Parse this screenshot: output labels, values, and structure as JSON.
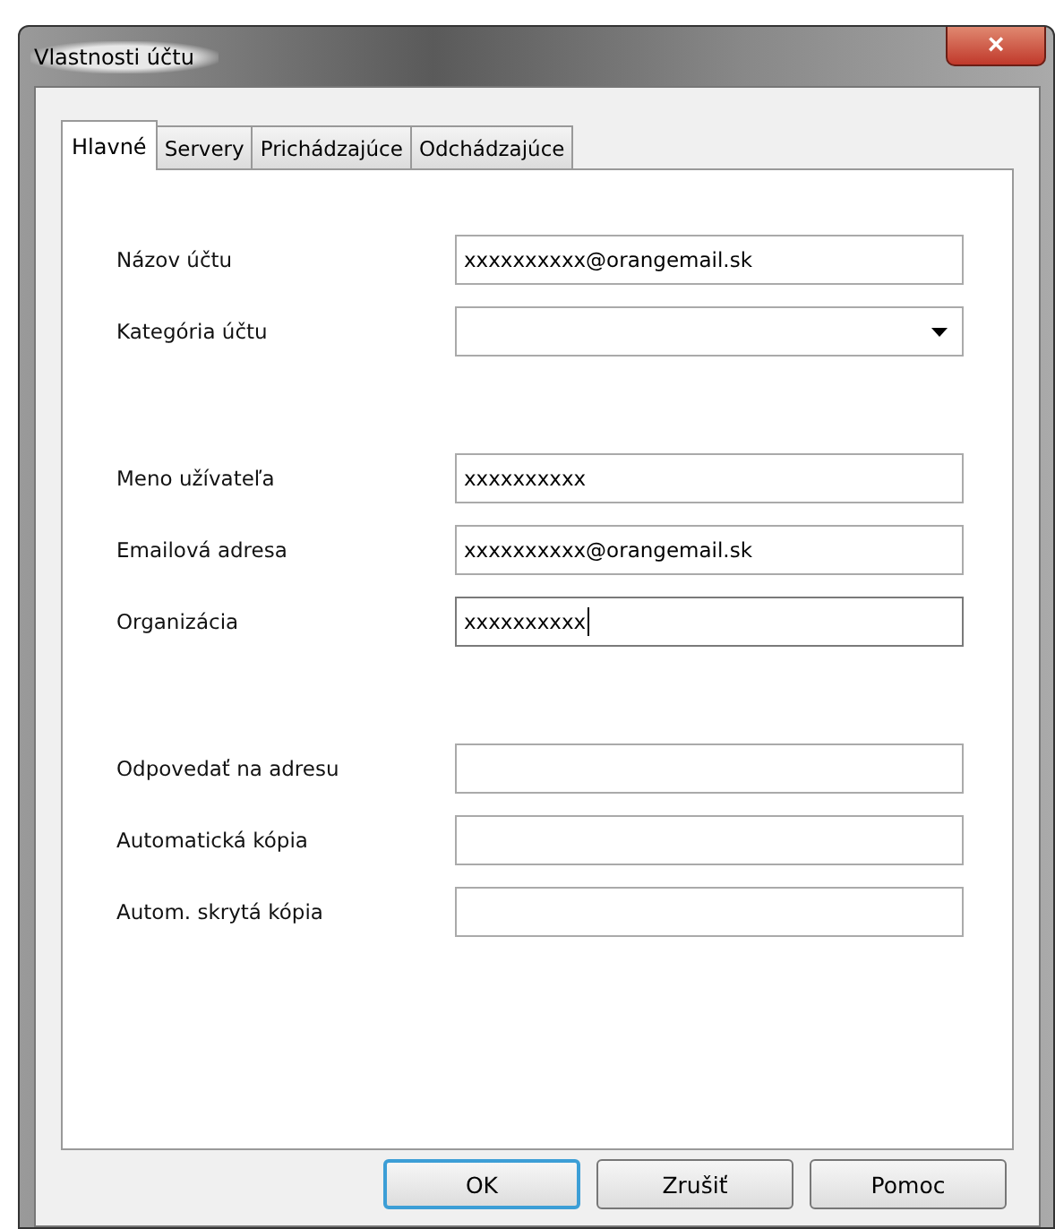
{
  "window": {
    "title": "Vlastnosti účtu",
    "close": "×"
  },
  "tabs": [
    {
      "label": "Hlavné",
      "selected": true
    },
    {
      "label": "Servery",
      "selected": false
    },
    {
      "label": "Prichádzajúce",
      "selected": false
    },
    {
      "label": "Odchádzajúce",
      "selected": false
    }
  ],
  "groups": [
    {
      "fields": [
        {
          "label": "Názov účtu",
          "kind": "text",
          "value": "xxxxxxxxxx@orangemail.sk",
          "focused": false
        },
        {
          "label": "Kategória účtu",
          "kind": "dropdown",
          "focused": false
        }
      ]
    },
    {
      "fields": [
        {
          "label": "Meno užívateľa",
          "kind": "text",
          "value": "xxxxxxxxxx",
          "focused": false
        },
        {
          "label": "Emailová adresa",
          "kind": "text",
          "value": "xxxxxxxxxx@orangemail.sk",
          "focused": false
        },
        {
          "label": "Organizácia",
          "kind": "text",
          "value": "xxxxxxxxxx",
          "focused": true
        }
      ]
    },
    {
      "fields": [
        {
          "label": "Odpovedať na adresu",
          "kind": "text",
          "focused": false
        },
        {
          "label": "Automatická kópia",
          "kind": "text",
          "focused": false
        },
        {
          "label": "Autom. skrytá kópia",
          "kind": "text",
          "focused": false
        }
      ]
    }
  ],
  "buttons": [
    {
      "label": "OK",
      "default": true
    },
    {
      "label": "Zrušiť",
      "default": false
    },
    {
      "label": "Pomoc",
      "default": false
    }
  ]
}
